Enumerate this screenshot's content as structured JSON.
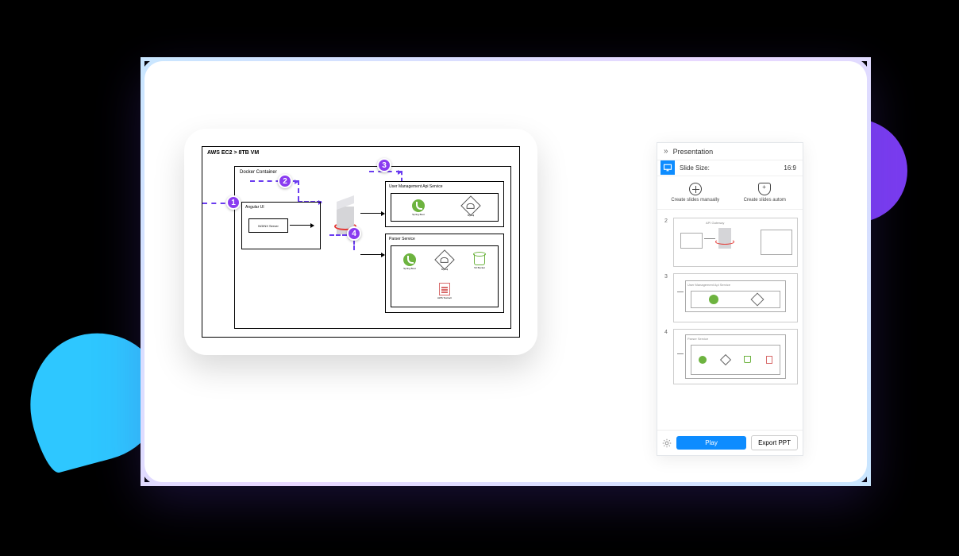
{
  "diagram": {
    "vm_title": "AWS EC2 > 8TB VM",
    "docker_title": "Docker Container",
    "angular_title": "Angular UI",
    "nginx_label": "NGINX Server",
    "svc1_title": "User Management Api Service",
    "svc2_title": "Parser Service",
    "tech": {
      "spring": "Spring Boot",
      "mysql": "MySql",
      "bucket": "S3 Bucket",
      "textract": "AWS Textract"
    },
    "badges": [
      "1",
      "2",
      "3",
      "4"
    ]
  },
  "panel": {
    "title": "Presentation",
    "slide_size_label": "Slide Size:",
    "slide_size_value": "16:9",
    "action_manual": "Create slides manually",
    "action_auto": "Create slides autom",
    "slides": [
      {
        "num": "2",
        "caption": "API Gateway"
      },
      {
        "num": "3",
        "caption": "User Management Api Service"
      },
      {
        "num": "4",
        "caption": "Parser Service"
      }
    ],
    "play": "Play",
    "export": "Export PPT"
  }
}
